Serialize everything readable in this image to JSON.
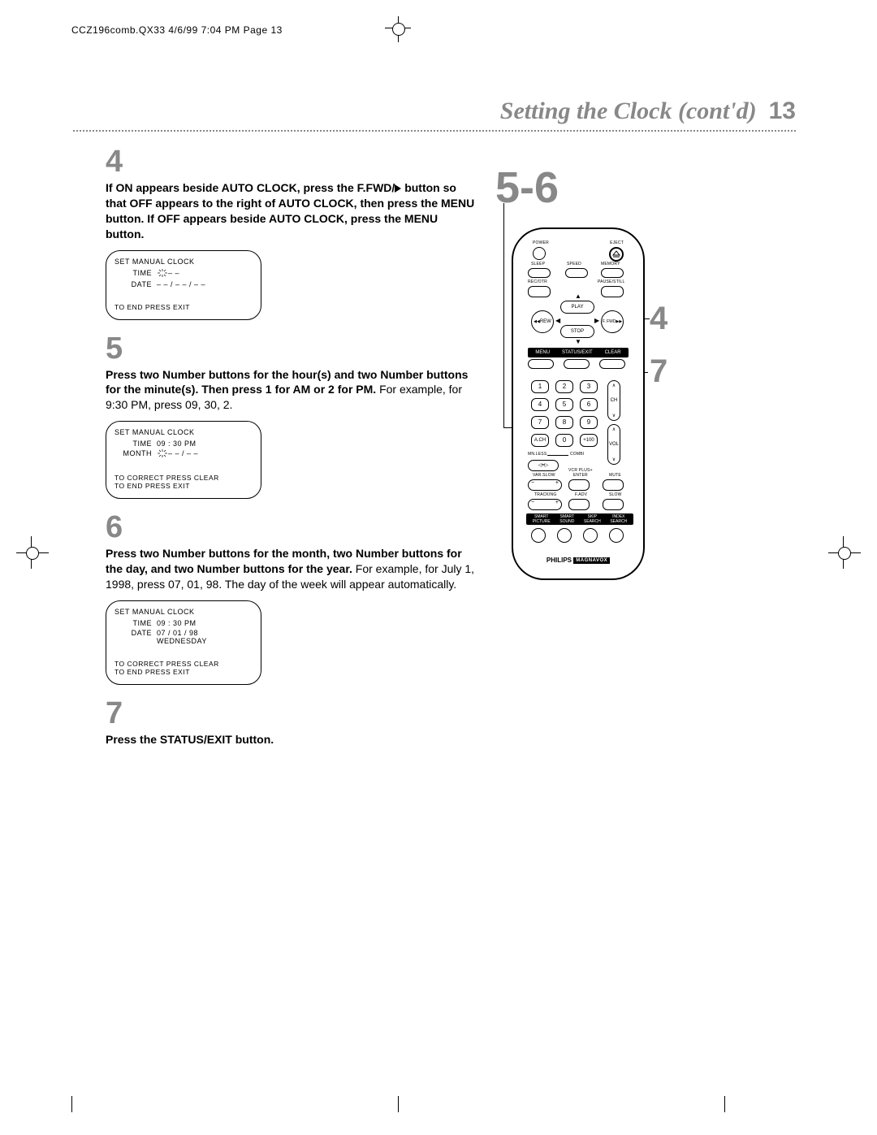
{
  "header": "CCZ196comb.QX33  4/6/99 7:04 PM  Page 13",
  "title": {
    "text": "Setting the Clock (cont'd)",
    "page_num": "13"
  },
  "steps": {
    "s4": {
      "num": "4",
      "text_bold": "If ON appears beside AUTO CLOCK, press the F.FWD/",
      "text_bold2": "button so that OFF appears to the right of AUTO CLOCK, then press the MENU button. If OFF appears beside AUTO CLOCK, press the MENU button.",
      "tv": {
        "title": "SET MANUAL CLOCK",
        "row1_lbl": "TIME",
        "row1_val": "– –",
        "row2_lbl": "DATE",
        "row2_val": "– – / – – / – –",
        "bottom1": "TO END PRESS EXIT"
      }
    },
    "s5": {
      "num": "5",
      "text_bold": "Press two Number buttons for the hour(s) and two Number buttons for the minute(s). Then press 1 for AM or 2 for PM.",
      "text_rest": " For example, for 9:30 PM, press 09, 30, 2.",
      "tv": {
        "title": "SET MANUAL CLOCK",
        "row1_lbl": "TIME",
        "row1_val": "09 : 30 PM",
        "row2_lbl": "MONTH",
        "row2_val": "– – / – –",
        "bottom1": "TO CORRECT PRESS CLEAR",
        "bottom2": "TO END PRESS EXIT"
      }
    },
    "s6": {
      "num": "6",
      "text_bold": "Press two Number buttons for the month, two Number buttons for the day, and two Number buttons for the year.",
      "text_rest": " For example, for July 1, 1998, press 07, 01, 98. The day of the week will appear automatically.",
      "tv": {
        "title": "SET MANUAL CLOCK",
        "row1_lbl": "TIME",
        "row1_val": "09 : 30 PM",
        "row2_lbl": "DATE",
        "row2_val": "07 / 01 / 98",
        "row2_val2": "WEDNESDAY",
        "bottom1": "TO CORRECT PRESS CLEAR",
        "bottom2": "TO END PRESS EXIT"
      }
    },
    "s7": {
      "num": "7",
      "text_bold": "Press the STATUS/EXIT button."
    }
  },
  "callouts": {
    "big": "5-6",
    "four": "4",
    "seven": "7"
  },
  "remote": {
    "power": "POWER",
    "eject": "EJECT",
    "sleep": "SLEEP",
    "speed": "SPEED",
    "memory": "MEMORY",
    "recotr": "REC/OTR",
    "pausestill": "PAUSE/STILL",
    "play": "PLAY",
    "rew": "REW",
    "ffwd": "F. FWD",
    "stop": "STOP",
    "menu": "MENU",
    "statusexit": "STATUS/EXIT",
    "clear": "CLEAR",
    "n1": "1",
    "n2": "2",
    "n3": "3",
    "n4": "4",
    "n5": "5",
    "n6": "6",
    "n7": "7",
    "n8": "8",
    "n9": "9",
    "n0": "0",
    "ach": "A.CH",
    "plus100": "+100",
    "ch": "CH",
    "vol": "VOL",
    "varslow": "VAR.SLOW",
    "vcrplus": "VCR PLUS+\nENTER",
    "mute": "MUTE",
    "tracking": "TRACKING",
    "fadv": "F.ADV",
    "slow": "SLOW",
    "smartpic": "SMART\nPICTURE",
    "smartsnd": "SMART\nSOUND",
    "skipsrch": "SKIP\nSEARCH",
    "indexsrch": "INDEX\nSEARCH",
    "mnless": "MN.LESS",
    "combi": "COMBI",
    "brand1": "PHILIPS",
    "brand2": "MAGNAVOX"
  }
}
